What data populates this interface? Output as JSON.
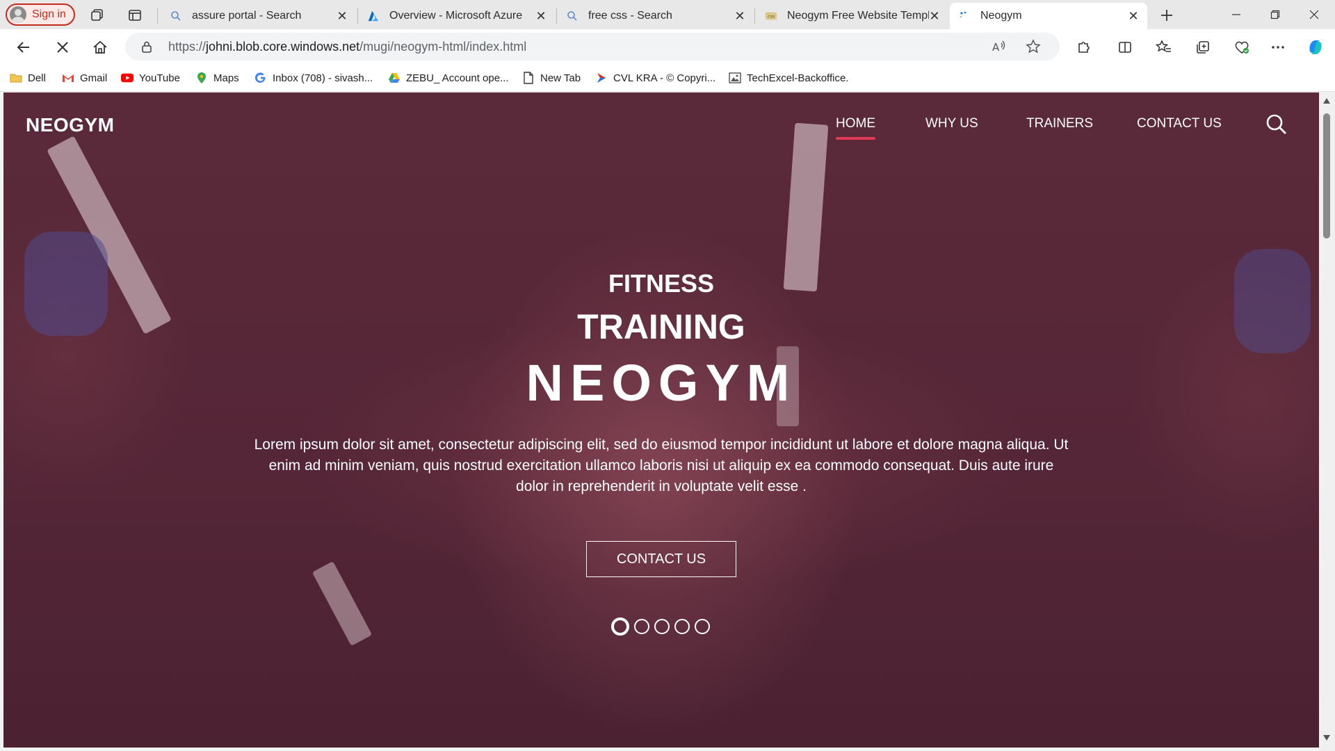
{
  "browser": {
    "signin_label": "Sign in",
    "tabs": [
      {
        "title": "assure portal - Search",
        "icon": "search-icon"
      },
      {
        "title": "Overview - Microsoft Azure",
        "icon": "azure-icon"
      },
      {
        "title": "free css - Search",
        "icon": "search-icon"
      },
      {
        "title": "Neogym Free Website Templat",
        "icon": "css-icon"
      },
      {
        "title": "Neogym",
        "icon": "loading-icon",
        "active": true
      }
    ],
    "address": {
      "prefix": "https://",
      "host": "johni.blob.core.windows.net",
      "path": "/mugi/neogym-html/index.html"
    },
    "bookmarks": [
      {
        "label": "Dell",
        "icon": "folder-icon"
      },
      {
        "label": "Gmail",
        "icon": "gmail-icon"
      },
      {
        "label": "YouTube",
        "icon": "youtube-icon"
      },
      {
        "label": "Maps",
        "icon": "maps-icon"
      },
      {
        "label": "Inbox (708) - sivash...",
        "icon": "google-icon"
      },
      {
        "label": "ZEBU_ Account ope...",
        "icon": "drive-icon"
      },
      {
        "label": "New Tab",
        "icon": "page-icon"
      },
      {
        "label": "CVL KRA - © Copyri...",
        "icon": "cvl-icon"
      },
      {
        "label": "TechExcel-Backoffice.",
        "icon": "image-icon"
      }
    ]
  },
  "site": {
    "logo": "NEOGYM",
    "nav": [
      {
        "label": "HOME",
        "active": true
      },
      {
        "label": "WHY US"
      },
      {
        "label": "TRAINERS"
      },
      {
        "label": "CONTACT US"
      }
    ],
    "hero": {
      "line1": "FITNESS",
      "line2": "TRAINING",
      "line3": "NEOGYM",
      "text": "Lorem ipsum dolor sit amet, consectetur adipiscing elit, sed do eiusmod tempor incididunt ut labore et dolore magna aliqua. Ut enim ad minim veniam, quis nostrud exercitation ullamco laboris nisi ut aliquip ex ea commodo consequat. Duis aute irure dolor in reprehenderit in voluptate velit esse .",
      "cta_label": "CONTACT US",
      "slides_total": 5,
      "slide_active": 1
    }
  },
  "colors": {
    "hero_overlay": "#552637",
    "nav_active_underline": "#e03a54",
    "signin_accent": "#c42b1c"
  }
}
